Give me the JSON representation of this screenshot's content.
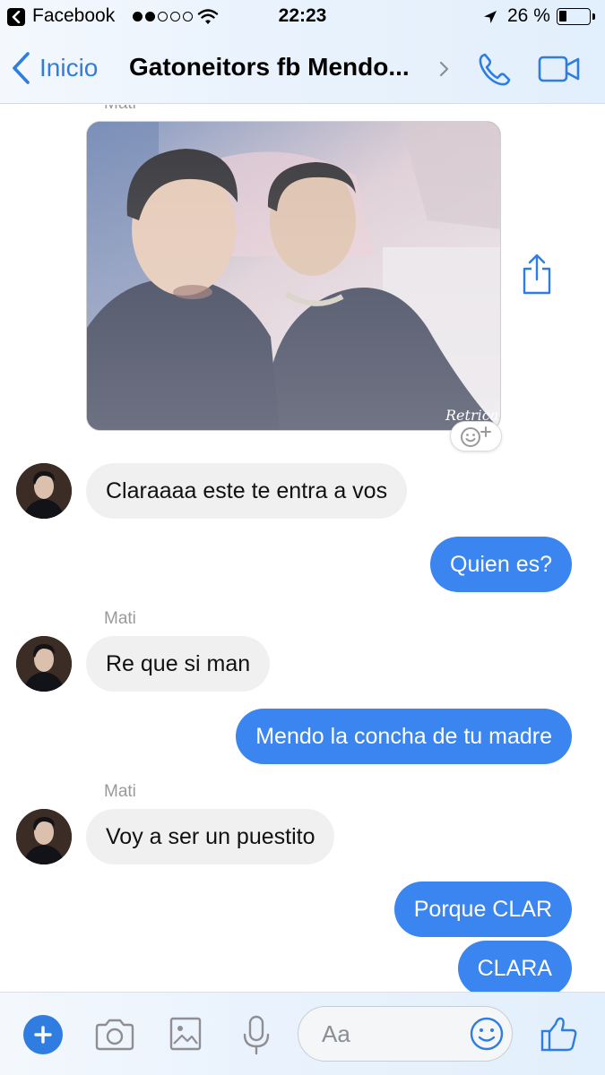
{
  "status_bar": {
    "app_name": "Facebook",
    "time": "22:23",
    "battery_text": "26 %",
    "battery_level": 0.26,
    "signal_bars_filled": 2,
    "signal_bars_total": 5
  },
  "nav": {
    "back_label": "Inicio",
    "title": "Gatoneitors fb Mendo...",
    "accent_color": "#2f7de1"
  },
  "chat": {
    "top_sender": "Mati",
    "photo_watermark": "Retrica",
    "messages": [
      {
        "side": "in",
        "text": "Claraaaa este te entra a vos"
      },
      {
        "side": "out",
        "text": "Quien es?"
      },
      {
        "side": "in",
        "sender": "Mati",
        "text": "Re que si man"
      },
      {
        "side": "out",
        "text": "Mendo la concha de tu madre"
      },
      {
        "side": "in",
        "sender": "Mati",
        "text": "Voy a ser un puestito"
      },
      {
        "side": "out",
        "text": "Porque CLAR"
      },
      {
        "side": "out",
        "text": "CLARA"
      }
    ],
    "incoming_bubble_color": "#f1f0f0",
    "outgoing_bubble_color": "#3a85f0"
  },
  "composer": {
    "placeholder": "Aa"
  }
}
